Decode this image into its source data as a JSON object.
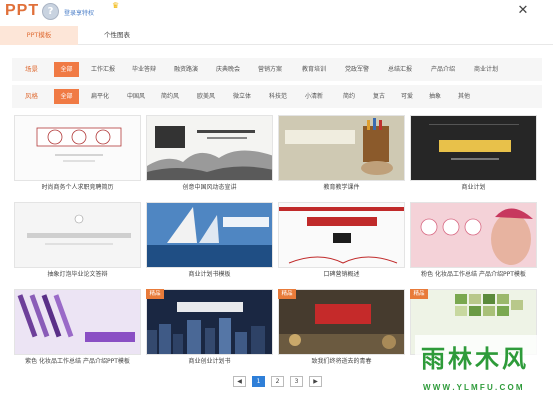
{
  "app": {
    "logo": "PPT",
    "avatar_glyph": "?",
    "login_text": "登录享特权",
    "crown_glyph": "♛",
    "close_glyph": "✕"
  },
  "tabs": [
    {
      "label": "PPT模板",
      "active": true
    },
    {
      "label": "个性图表",
      "active": false
    }
  ],
  "filters": {
    "scene": {
      "label": "场景",
      "options": [
        "全部",
        "工作汇报",
        "毕业答辩",
        "融资路演",
        "庆典晚会",
        "营销方案",
        "教育培训",
        "党政军警",
        "总结汇报",
        "产品介绍",
        "商业计划"
      ]
    },
    "style": {
      "label": "风格",
      "options": [
        "全部",
        "扁平化",
        "中国风",
        "简约风",
        "欧美风",
        "微立体",
        "科技范",
        "小清新",
        "简约",
        "复古",
        "可爱",
        "抽象",
        "其他"
      ]
    }
  },
  "templates": [
    {
      "caption": "时尚商务个人求职竞聘简历",
      "thumb_text": "竞聘 求职 简历",
      "badge": ""
    },
    {
      "caption": "创意中国风动态宣讲",
      "thumb_text": "创意中国风 动态宣讲",
      "badge": ""
    },
    {
      "caption": "教育教学课件",
      "thumb_text": "教育教学课件",
      "badge": ""
    },
    {
      "caption": "商业计划",
      "thumb_text": "商业创业计划书",
      "badge": ""
    },
    {
      "caption": "抽象灯泡毕业论文答辩",
      "thumb_text": "抽象灯泡毕业论文答辩",
      "badge": ""
    },
    {
      "caption": "商业计划书模板",
      "thumb_text": "商业计划书模板",
      "badge": ""
    },
    {
      "caption": "口碑营销概述",
      "thumb_text": "口碑营销概述",
      "badge": ""
    },
    {
      "caption": "粉色 化妆品工作总结 产品介绍PPT模板",
      "thumb_text": "粉色化妆品",
      "badge": ""
    },
    {
      "caption": "紫色 化妆品工作总结 产品介绍PPT模板",
      "thumb_text": "时尚彩妆",
      "badge": ""
    },
    {
      "caption": "商业创业计划书",
      "thumb_text": "商业创业计划书",
      "badge": "精品"
    },
    {
      "caption": "致我们终将逝去的青春",
      "thumb_text": "致青春",
      "badge": "精品"
    },
    {
      "caption": "",
      "thumb_text": "",
      "badge": "精品"
    }
  ],
  "pagination": {
    "prev": "◀",
    "next": "▶",
    "pages": [
      "1",
      "2",
      "3"
    ],
    "current": "1"
  },
  "watermark": {
    "title": "雨林木风",
    "url": "W W W . Y L M F U . C O M"
  },
  "colors": {
    "accent": "#f07a44",
    "tab_active_bg": "#fde6d8",
    "filter_bg": "#f6f6f6",
    "page_active": "#2f7fd8",
    "badge": "#e87b3a"
  }
}
